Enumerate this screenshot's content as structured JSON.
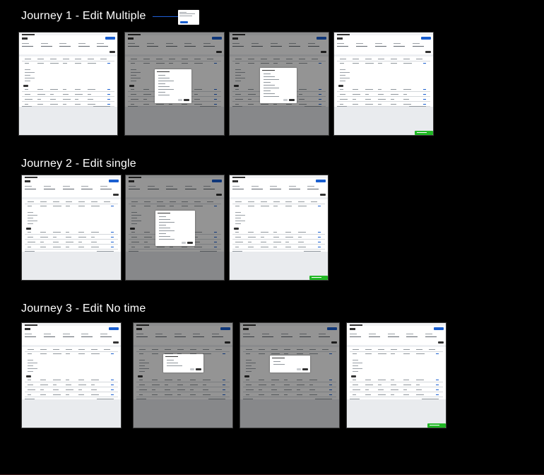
{
  "journeys": [
    {
      "title": "Journey 1 - Edit Multiple",
      "screen_count": 4
    },
    {
      "title": "Journey 2 - Edit single",
      "screen_count": 3
    },
    {
      "title": "Journey 3 - Edit No time",
      "screen_count": 4
    }
  ],
  "screen_states": {
    "normal": "Edit page",
    "modal": "Edit dialog over dimmed page",
    "success": "Page with success toast"
  },
  "colors": {
    "canvas_background": "#000000",
    "title_text": "#ffffff",
    "primary_button": "#1a5fd0",
    "success_toast": "#22b826",
    "connector": "#1f5fd6"
  }
}
